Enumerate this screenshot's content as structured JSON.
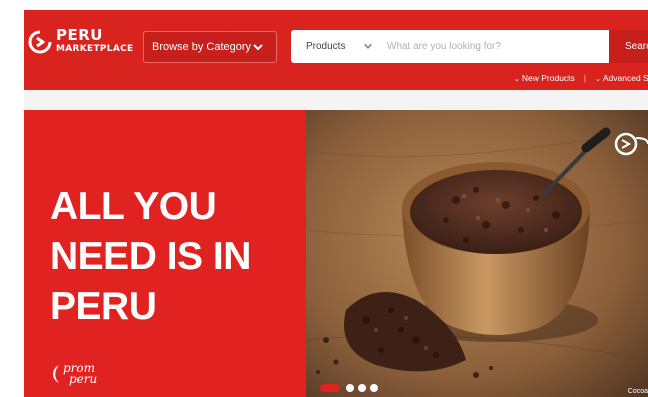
{
  "header": {
    "logo": {
      "line1": "PERU",
      "line2": "MARKETPLACE"
    },
    "category_button": {
      "label": "Browse by Category"
    },
    "search": {
      "scope": "Products",
      "placeholder": "What are you looking for?",
      "button_label": "Search"
    },
    "links": [
      {
        "label": "New Products"
      },
      {
        "label": "Advanced Search"
      }
    ]
  },
  "hero": {
    "title_lines": [
      "ALL YOU",
      "NEED IS IN",
      "PERU"
    ],
    "brand": {
      "line1": "prom",
      "line2": "peru"
    },
    "slide_caption": "Cocoa",
    "carousel": {
      "slides": 4,
      "active": 1
    }
  },
  "colors": {
    "brand_red": "#d8231e",
    "hero_red": "#e02320"
  }
}
